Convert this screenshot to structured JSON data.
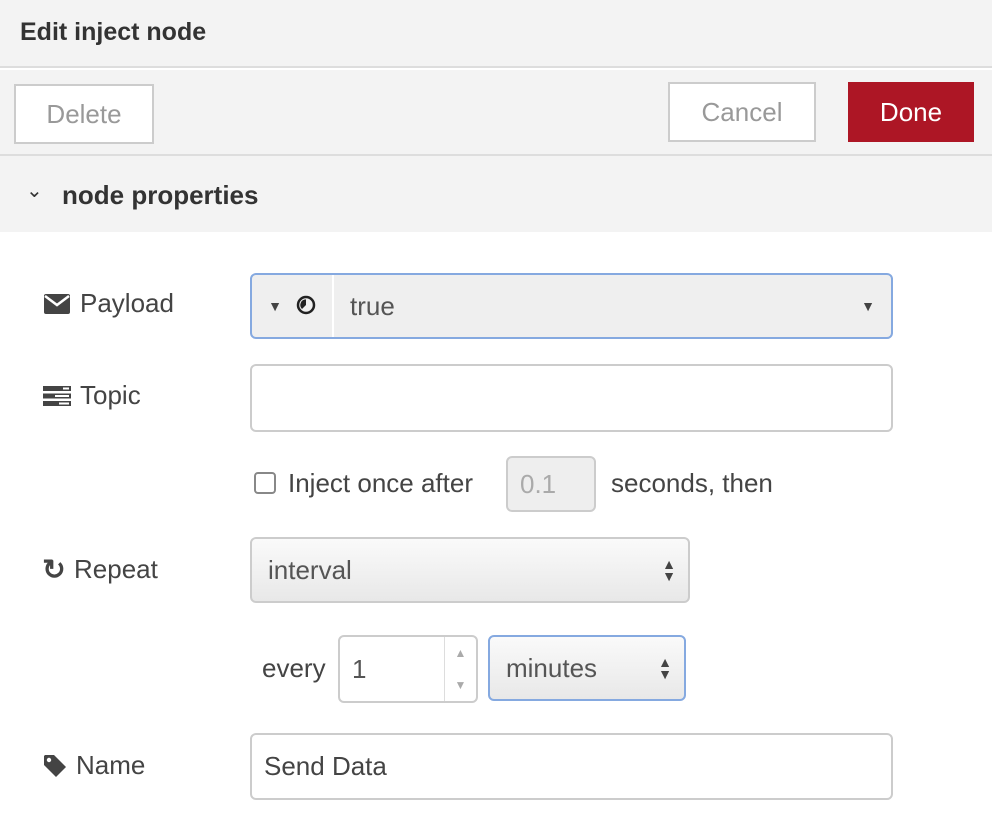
{
  "title": "Edit inject node",
  "toolbar": {
    "delete": "Delete",
    "cancel": "Cancel",
    "done": "Done",
    "done_color": "#ad1625"
  },
  "section": {
    "label": "node properties"
  },
  "payload": {
    "label": "Payload",
    "type_icon": "boolean-icon",
    "value": "true"
  },
  "topic": {
    "label": "Topic",
    "value": ""
  },
  "inject_once": {
    "label": "Inject once after",
    "checked": false,
    "delay": "0.1",
    "suffix": "seconds, then"
  },
  "repeat": {
    "label": "Repeat",
    "value": "interval"
  },
  "every": {
    "label": "every",
    "value": "1",
    "unit": "minutes"
  },
  "name": {
    "label": "Name",
    "value": "Send Data"
  }
}
